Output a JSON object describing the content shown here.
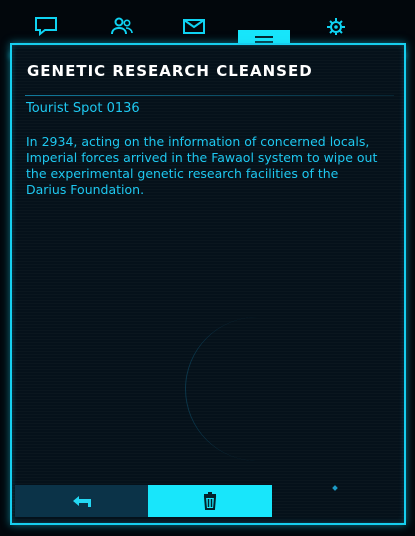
{
  "tabs": [
    {
      "icon": "chat-icon"
    },
    {
      "icon": "friends-icon"
    },
    {
      "icon": "mail-icon"
    },
    {
      "icon": "menu-icon",
      "active": true
    },
    {
      "icon": "gear-icon"
    }
  ],
  "article": {
    "title": "GENETIC RESEARCH CLEANSED",
    "subtitle": "Tourist Spot 0136",
    "body": "In 2934, acting on the information of concerned locals, Imperial forces arrived in the Fawaol system to wipe out the experimental genetic research facilities of the Darius Foundation."
  },
  "buttons": {
    "back_icon": "back-arrow-icon",
    "delete_icon": "trash-icon"
  },
  "colors": {
    "accent": "#18e6fb",
    "text": "#1ec8f0",
    "background": "#05111a"
  }
}
